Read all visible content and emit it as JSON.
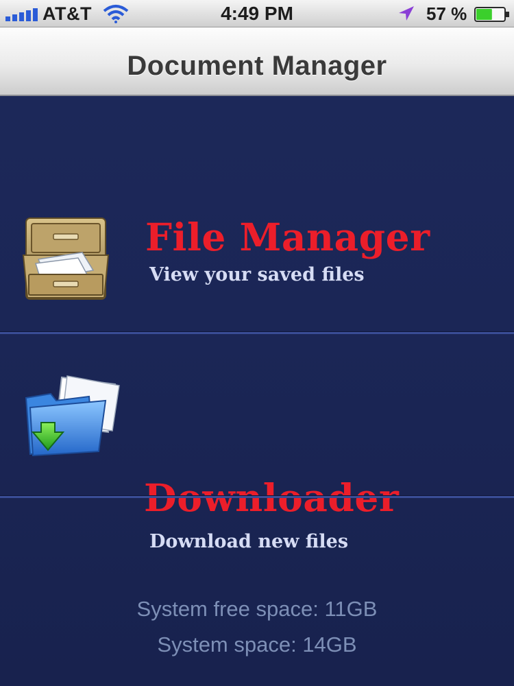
{
  "status_bar": {
    "carrier": "AT&T",
    "time": "4:49 PM",
    "battery_percent": "57 %",
    "battery_level": 0.57,
    "icons": [
      "signal-bars-icon",
      "wifi-icon",
      "location-arrow-icon",
      "battery-icon"
    ]
  },
  "nav": {
    "title": "Document Manager"
  },
  "menu": {
    "items": [
      {
        "title": "File Manager",
        "subtitle": "View your saved files",
        "icon": "file-cabinet-icon"
      },
      {
        "title": "Downloader",
        "subtitle": "Download new files",
        "icon": "folder-download-icon"
      }
    ]
  },
  "storage": {
    "free": "System free space: 11GB",
    "total": "System space: 14GB"
  },
  "colors": {
    "title_red": "#ec1e2a",
    "background_navy": "#1c2859",
    "subtitle": "#d6dcf4",
    "storage_text": "#7d8fb6",
    "divider": "#3a4d96",
    "battery_green": "#3bcf2c",
    "location_purple": "#8a3fd6"
  }
}
